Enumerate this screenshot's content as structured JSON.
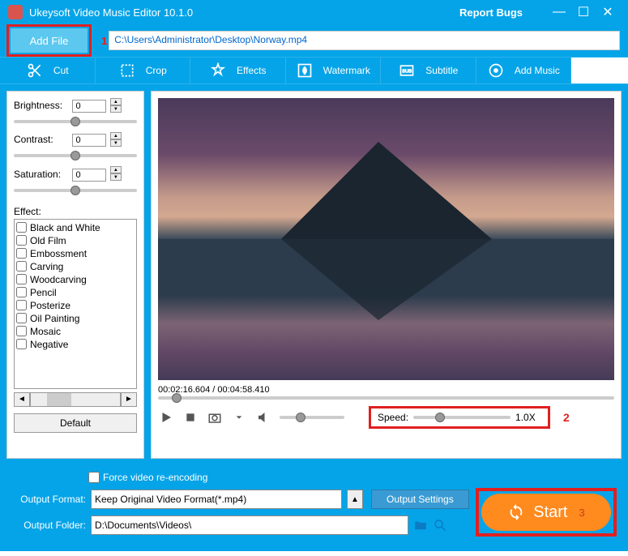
{
  "titlebar": {
    "app_title": "Ukeysoft Video Music Editor 10.1.0",
    "report_bugs": "Report Bugs"
  },
  "filebar": {
    "add_file": "Add File",
    "step1": "1",
    "path": "C:\\Users\\Administrator\\Desktop\\Norway.mp4"
  },
  "tabs": {
    "cut": "Cut",
    "crop": "Crop",
    "effects": "Effects",
    "watermark": "Watermark",
    "subtitle": "Subtitle",
    "add_music": "Add Music"
  },
  "sliders": {
    "brightness_label": "Brightness:",
    "brightness_val": "0",
    "contrast_label": "Contrast:",
    "contrast_val": "0",
    "saturation_label": "Saturation:",
    "saturation_val": "0"
  },
  "effects": {
    "label": "Effect:",
    "items": [
      "Black and White",
      "Old Film",
      "Embossment",
      "Carving",
      "Woodcarving",
      "Pencil",
      "Posterize",
      "Oil Painting",
      "Mosaic",
      "Negative"
    ],
    "default_btn": "Default"
  },
  "player": {
    "time": "00:02:16.604 / 00:04:58.410",
    "speed_label": "Speed:",
    "speed_val": "1.0X",
    "step2": "2"
  },
  "bottom": {
    "force": "Force video re-encoding",
    "format_label": "Output Format:",
    "format_val": "Keep Original Video Format(*.mp4)",
    "settings_btn": "Output Settings",
    "folder_label": "Output Folder:",
    "folder_val": "D:\\Documents\\Videos\\",
    "start": "Start",
    "step3": "3"
  }
}
